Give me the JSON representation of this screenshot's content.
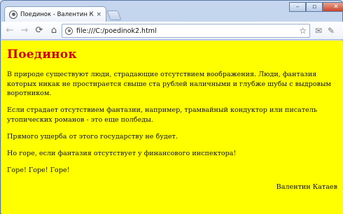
{
  "browser": {
    "tab_title": "Поединок - Валентин Катаев",
    "tab_close": "×",
    "url": "file:///C:/poedinok2.html",
    "window_controls": {
      "minimize": "–",
      "maximize": "▫",
      "close": "✕"
    },
    "nav": {
      "back": "←",
      "forward": "→",
      "reload": "⟳",
      "home": "⌂",
      "star": "☆",
      "mail": "✉",
      "wrench": "✎"
    },
    "icons": [
      "page-icon",
      "star-icon",
      "mail-icon",
      "wrench-icon"
    ]
  },
  "page": {
    "background": "#ffff00",
    "heading_color": "#d40000",
    "heading": "Поединок",
    "paragraphs": [
      "В природе существуют люди, страдающие отсутствием воображения. Люди, фантазия которых никак не простирается свыше ста рублей наличными и глубже шубы с выдровым воротником.",
      "Если страдает отсутствием фантазии, например, трамвайный кондуктор или писатель утопических романов - это еще полбеды.",
      "Прямого ущерба от этого государству не будет.",
      "Но горе, если фантазия отсутствует у финансового инспектора!",
      "Горе! Горе! Горе!"
    ],
    "signature": "Валентин Катаев"
  }
}
